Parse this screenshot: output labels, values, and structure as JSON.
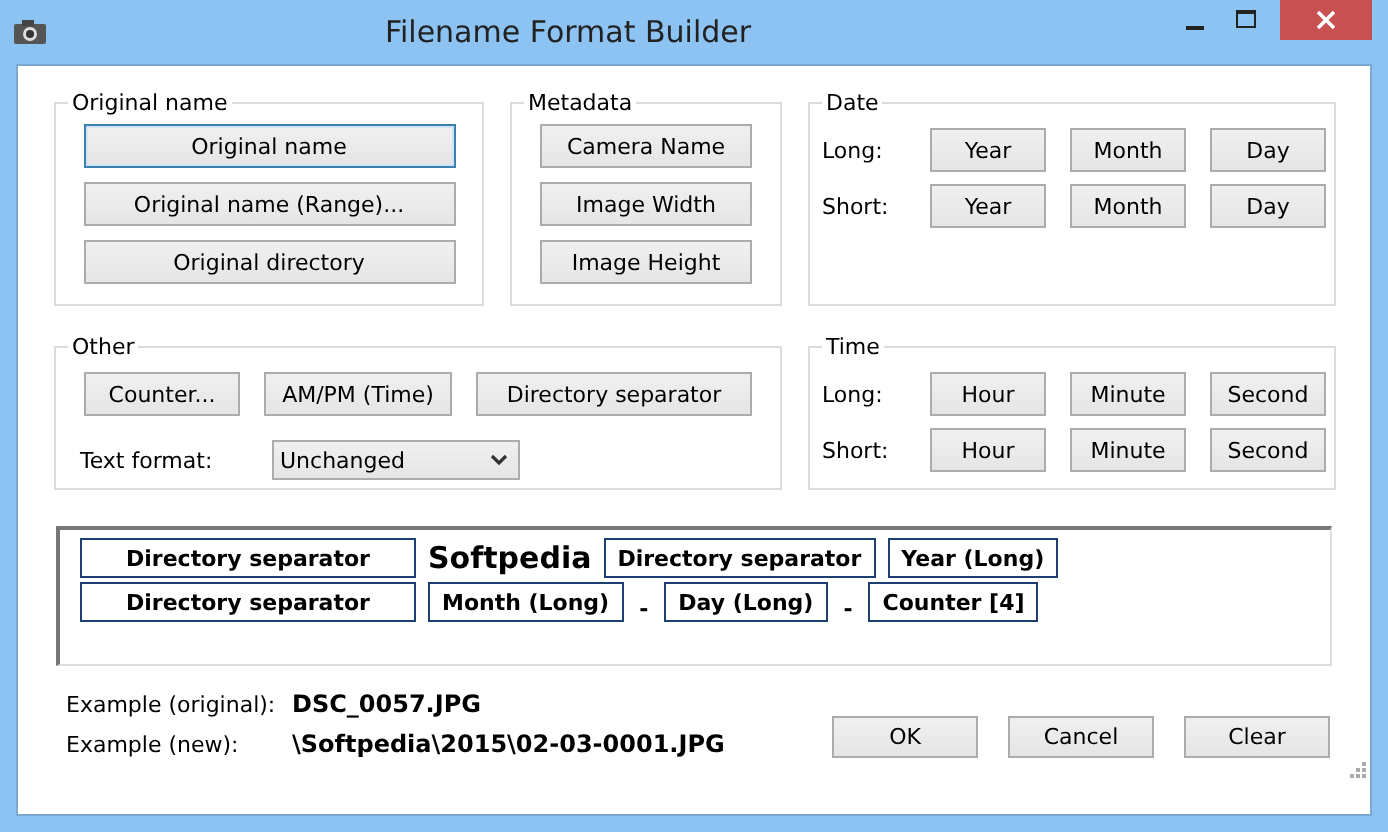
{
  "window": {
    "title": "Filename Format Builder"
  },
  "original_name": {
    "title": "Original name",
    "buttons": [
      {
        "label": "Original name",
        "focused": true
      },
      {
        "label": "Original name (Range)...",
        "focused": false
      },
      {
        "label": "Original directory",
        "focused": false
      }
    ]
  },
  "metadata": {
    "title": "Metadata",
    "buttons": [
      "Camera Name",
      "Image Width",
      "Image Height"
    ]
  },
  "date": {
    "title": "Date",
    "rows": [
      {
        "label": "Long:",
        "buttons": [
          "Year",
          "Month",
          "Day"
        ]
      },
      {
        "label": "Short:",
        "buttons": [
          "Year",
          "Month",
          "Day"
        ]
      }
    ]
  },
  "other": {
    "title": "Other",
    "buttons": [
      "Counter...",
      "AM/PM (Time)",
      "Directory separator"
    ],
    "text_format": {
      "label": "Text format:",
      "value": "Unchanged"
    }
  },
  "time": {
    "title": "Time",
    "rows": [
      {
        "label": "Long:",
        "buttons": [
          "Hour",
          "Minute",
          "Second"
        ]
      },
      {
        "label": "Short:",
        "buttons": [
          "Hour",
          "Minute",
          "Second"
        ]
      }
    ]
  },
  "format": {
    "lines": [
      [
        {
          "kind": "token",
          "text": "Directory separator"
        },
        {
          "kind": "literal",
          "text": "Softpedia"
        },
        {
          "kind": "token",
          "text": "Directory separator"
        },
        {
          "kind": "token",
          "text": "Year (Long)"
        }
      ],
      [
        {
          "kind": "token",
          "text": "Directory separator"
        },
        {
          "kind": "token",
          "text": "Month (Long)"
        },
        {
          "kind": "separator",
          "text": "-"
        },
        {
          "kind": "token",
          "text": "Day (Long)"
        },
        {
          "kind": "separator",
          "text": "-"
        },
        {
          "kind": "token",
          "text": "Counter [4]"
        }
      ]
    ]
  },
  "examples": [
    {
      "label": "Example (original):",
      "value": "DSC_0057.JPG"
    },
    {
      "label": "Example (new):",
      "value": "\\Softpedia\\2015\\02-03-0001.JPG"
    }
  ],
  "buttons": [
    "OK",
    "Cancel",
    "Clear"
  ]
}
